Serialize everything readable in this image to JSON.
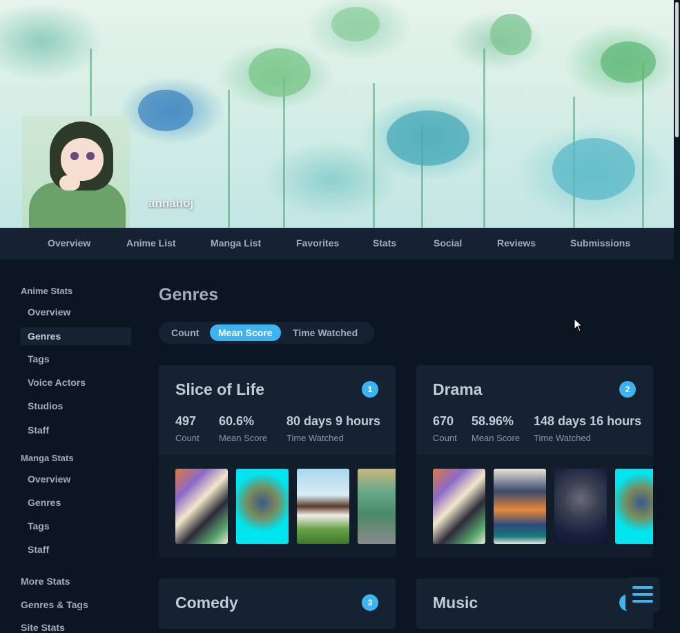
{
  "profile": {
    "username": "annahoj"
  },
  "nav": {
    "links": [
      "Overview",
      "Anime List",
      "Manga List",
      "Favorites",
      "Stats",
      "Social",
      "Reviews",
      "Submissions"
    ]
  },
  "sidebar": {
    "anime_heading": "Anime Stats",
    "anime_items": [
      "Overview",
      "Genres",
      "Tags",
      "Voice Actors",
      "Studios",
      "Staff"
    ],
    "manga_heading": "Manga Stats",
    "manga_items": [
      "Overview",
      "Genres",
      "Tags",
      "Staff"
    ],
    "more_stats": "More Stats",
    "genres_tags": "Genres & Tags",
    "site_stats": "Site Stats"
  },
  "main": {
    "title": "Genres",
    "tabs": [
      "Count",
      "Mean Score",
      "Time Watched"
    ],
    "active_tab": "Mean Score",
    "cards": [
      {
        "name": "Slice of Life",
        "rank": "1",
        "count": "497",
        "count_label": "Count",
        "mean": "60.6%",
        "mean_label": "Mean Score",
        "time": "80 days 9 hours",
        "time_label": "Time Watched"
      },
      {
        "name": "Drama",
        "rank": "2",
        "count": "670",
        "count_label": "Count",
        "mean": "58.96%",
        "mean_label": "Mean Score",
        "time": "148 days 16 hours",
        "time_label": "Time Watched"
      },
      {
        "name": "Comedy",
        "rank": "3"
      },
      {
        "name": "Music",
        "rank": "4"
      }
    ]
  },
  "colors": {
    "accent": "#3db4f2",
    "background": "#0b1622",
    "panel": "#152232"
  },
  "icons": {
    "menu": "hamburger-menu-icon",
    "cursor": "mouse-pointer-icon"
  }
}
